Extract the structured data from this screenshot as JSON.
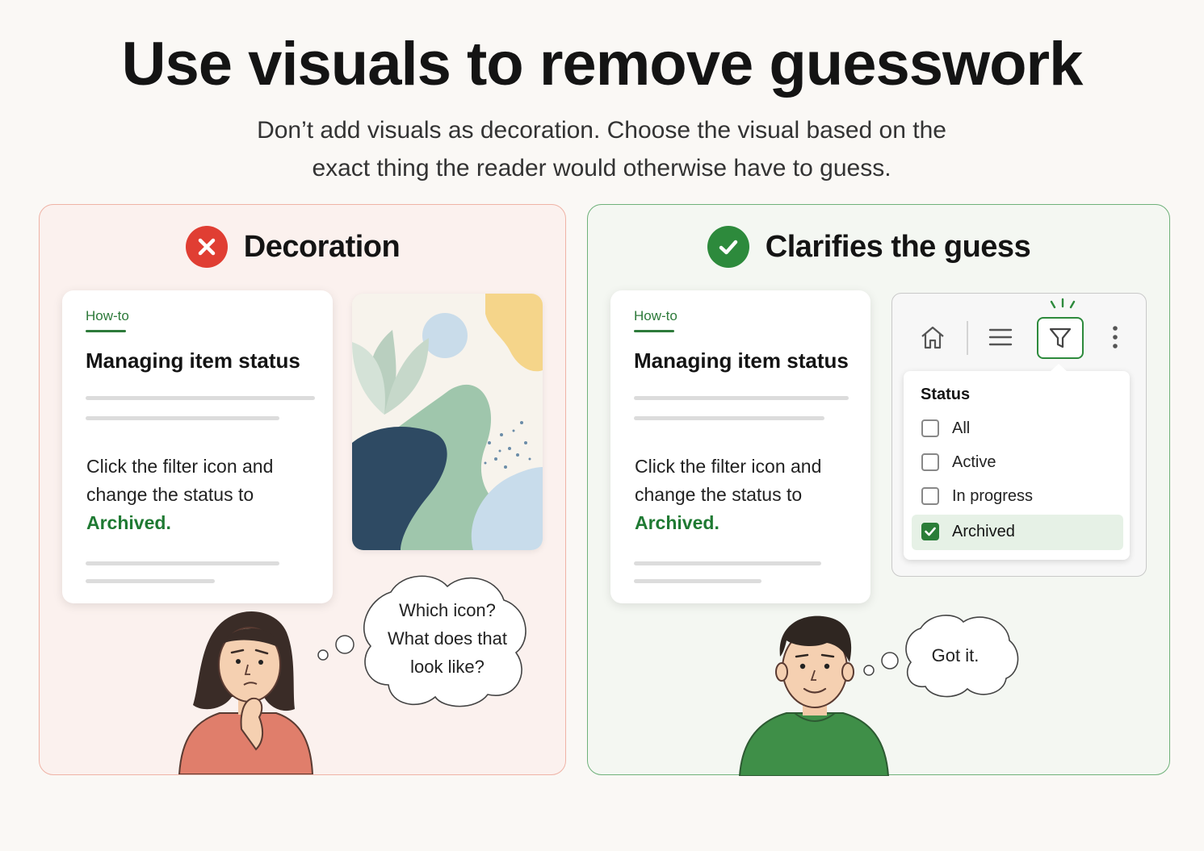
{
  "header": {
    "title": "Use visuals to remove guesswork",
    "subtitle_line1": "Don’t add visuals as decoration. Choose the visual based on the",
    "subtitle_line2": "exact thing the reader would otherwise have to guess."
  },
  "left_panel": {
    "heading": "Decoration",
    "status_icon": "x-circle-icon",
    "card": {
      "kicker": "How-to",
      "title": "Managing item status",
      "body_line1": "Click the filter icon and",
      "body_line2": "change the status to",
      "body_highlight": "Archived",
      "body_end": "."
    },
    "thought": {
      "line1": "Which icon?",
      "line2": "What does that",
      "line3": "look like?"
    }
  },
  "right_panel": {
    "heading": "Clarifies the guess",
    "status_icon": "check-circle-icon",
    "card": {
      "kicker": "How-to",
      "title": "Managing item status",
      "body_line1": "Click the filter icon and",
      "body_line2": "change the status to",
      "body_highlight": "Archived",
      "body_end": "."
    },
    "toolbar": {
      "icons": [
        "home-icon",
        "menu-icon",
        "filter-icon",
        "more-vertical-icon"
      ],
      "dropdown": {
        "title": "Status",
        "options": [
          {
            "label": "All",
            "checked": false
          },
          {
            "label": "Active",
            "checked": false
          },
          {
            "label": "In progress",
            "checked": false
          },
          {
            "label": "Archived",
            "checked": true
          }
        ]
      }
    },
    "thought": {
      "line1": "Got it."
    }
  },
  "colors": {
    "bad_accent": "#e03e33",
    "good_accent": "#2d8a3c",
    "highlight_text": "#1f7a33"
  }
}
